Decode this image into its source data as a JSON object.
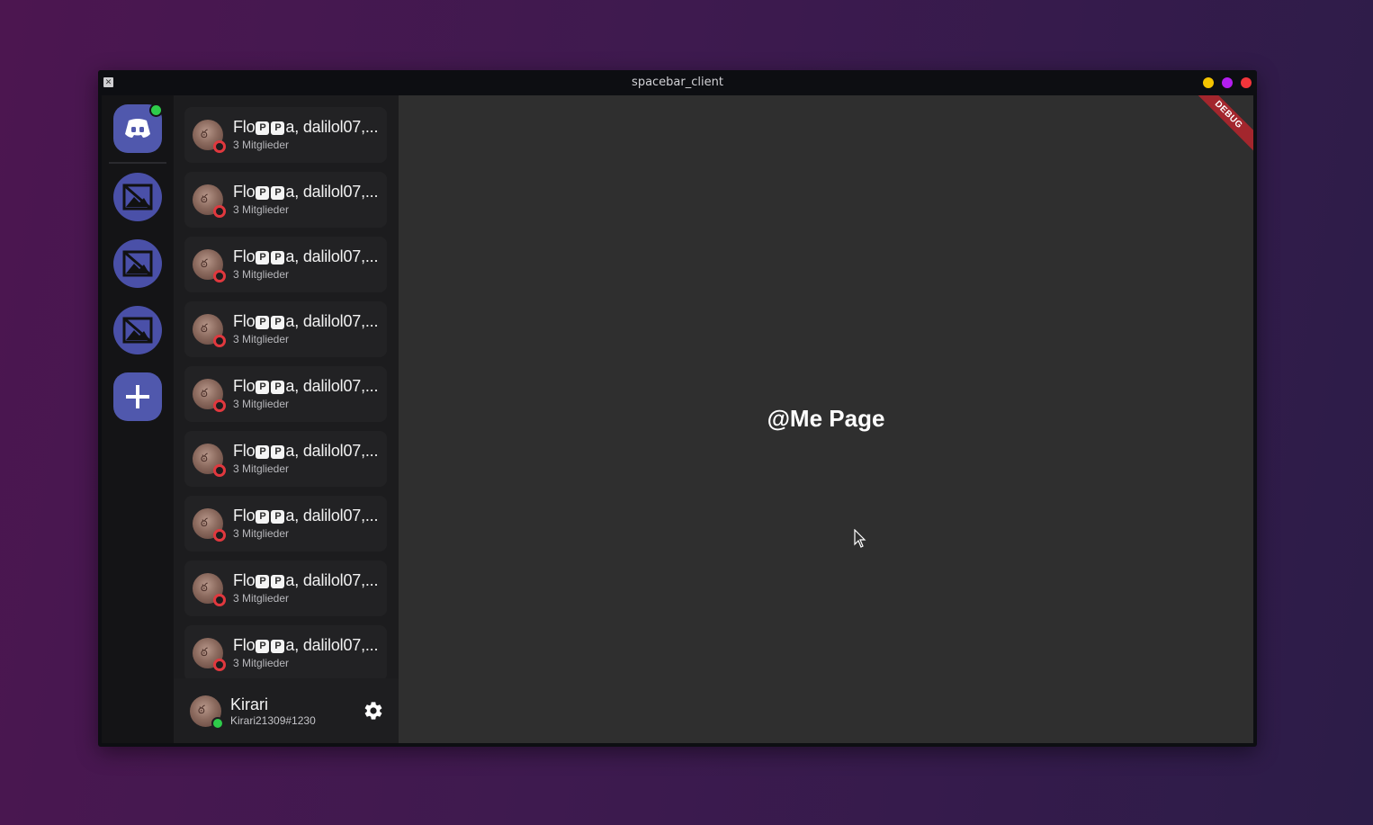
{
  "window": {
    "title": "spacebar_client",
    "buttons": {
      "minimize_color": "#f5c400",
      "maximize_color": "#b41ef0",
      "close_color": "#f2353b"
    }
  },
  "servers": {
    "home_icon": "discord-controller-icon",
    "items": [
      {
        "icon": "image-placeholder-icon"
      },
      {
        "icon": "image-placeholder-icon"
      },
      {
        "icon": "image-placeholder-icon"
      }
    ],
    "add_icon": "plus-icon"
  },
  "dm_list": {
    "items": [
      {
        "name_prefix": "Flo",
        "emoji": [
          "P",
          "P"
        ],
        "name_suffix": "a, dalilol07,...",
        "subtitle": "3 Mitglieder"
      },
      {
        "name_prefix": "Flo",
        "emoji": [
          "P",
          "P"
        ],
        "name_suffix": "a, dalilol07,...",
        "subtitle": "3 Mitglieder"
      },
      {
        "name_prefix": "Flo",
        "emoji": [
          "P",
          "P"
        ],
        "name_suffix": "a, dalilol07,...",
        "subtitle": "3 Mitglieder"
      },
      {
        "name_prefix": "Flo",
        "emoji": [
          "P",
          "P"
        ],
        "name_suffix": "a, dalilol07,...",
        "subtitle": "3 Mitglieder"
      },
      {
        "name_prefix": "Flo",
        "emoji": [
          "P",
          "P"
        ],
        "name_suffix": "a, dalilol07,...",
        "subtitle": "3 Mitglieder"
      },
      {
        "name_prefix": "Flo",
        "emoji": [
          "P",
          "P"
        ],
        "name_suffix": "a, dalilol07,...",
        "subtitle": "3 Mitglieder"
      },
      {
        "name_prefix": "Flo",
        "emoji": [
          "P",
          "P"
        ],
        "name_suffix": "a, dalilol07,...",
        "subtitle": "3 Mitglieder"
      },
      {
        "name_prefix": "Flo",
        "emoji": [
          "P",
          "P"
        ],
        "name_suffix": "a, dalilol07,...",
        "subtitle": "3 Mitglieder"
      },
      {
        "name_prefix": "Flo",
        "emoji": [
          "P",
          "P"
        ],
        "name_suffix": "a, dalilol07,...",
        "subtitle": "3 Mitglieder"
      }
    ]
  },
  "user": {
    "name": "Kirari",
    "tag": "Kirari21309#1230",
    "status_color": "#2ecc4a"
  },
  "main": {
    "title": "@Me Page",
    "debug_banner": "DEBUG"
  },
  "colors": {
    "accent": "#5058ad",
    "dnd": "#e0383e",
    "online": "#2ecc4a"
  }
}
